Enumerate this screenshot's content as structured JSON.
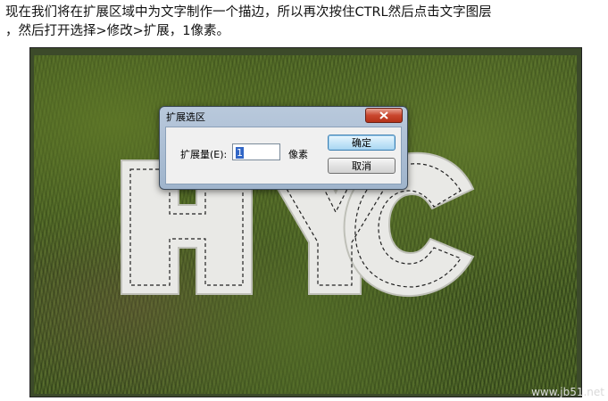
{
  "caption": {
    "line1": "现在我们将在扩展区域中为文字制作一个描边，所以再次按住CTRL然后点击文字图层",
    "line2": "，然后打开选择>修改>扩展，1像素。"
  },
  "canvas": {
    "artwork_text": "HYC"
  },
  "dialog": {
    "title": "扩展选区",
    "field_label": "扩展量(E):",
    "field_value": "1",
    "unit": "像素",
    "ok_label": "确定",
    "cancel_label": "取消"
  },
  "watermark": "www.jb51.net"
}
